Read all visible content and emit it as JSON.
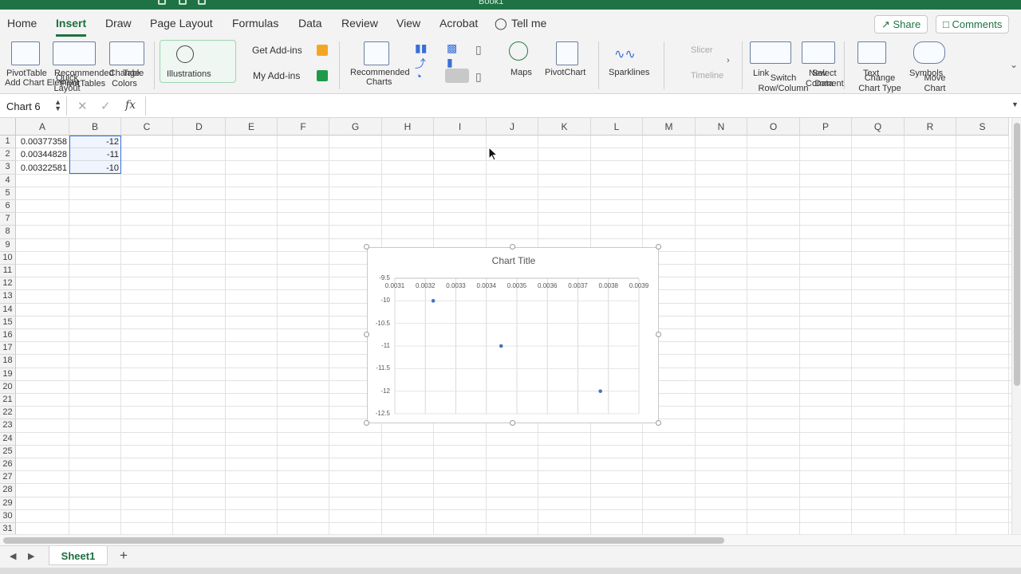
{
  "window": {
    "title": "Book1"
  },
  "tabs": [
    {
      "label": "Home"
    },
    {
      "label": "Insert"
    },
    {
      "label": "Draw"
    },
    {
      "label": "Page Layout"
    },
    {
      "label": "Formulas"
    },
    {
      "label": "Data"
    },
    {
      "label": "Review"
    },
    {
      "label": "View"
    },
    {
      "label": "Acrobat"
    },
    {
      "label": "Tell me"
    }
  ],
  "header_buttons": {
    "share": "Share",
    "comments": "Comments"
  },
  "ribbon": {
    "pivottable": "PivotTable",
    "add_chart_element": "Add Chart Element",
    "recommended_pivottables": "Recommended PivotTables",
    "quick_layout": "Quick Layout",
    "change_colors": "Change Colors",
    "table": "Table",
    "illustrations": "Illustrations",
    "get_addins": "Get Add-ins",
    "my_addins": "My Add-ins",
    "recommended_charts_1": "Recommended",
    "recommended_charts_2": "Charts",
    "maps": "Maps",
    "pivotchart": "PivotChart",
    "sparklines": "Sparklines",
    "slicer": "Slicer",
    "timeline": "Timeline",
    "link": "Link",
    "switch_rowcol": "Switch Row/Column",
    "new_comment": "New Comment",
    "select_data": "Select Data",
    "text": "Text",
    "change_chart_type": "Change Chart Type",
    "symbols": "Symbols",
    "move_chart": "Move Chart"
  },
  "formula_bar": {
    "name_box": "Chart 6",
    "fx": "fx",
    "formula": ""
  },
  "columns": [
    "A",
    "B",
    "C",
    "D",
    "E",
    "F",
    "G",
    "H",
    "I",
    "J",
    "K",
    "L",
    "M",
    "N",
    "O",
    "P",
    "Q",
    "R",
    "S"
  ],
  "rows": [
    "1",
    "2",
    "3",
    "4",
    "5",
    "6",
    "7",
    "8",
    "9",
    "10",
    "11",
    "12",
    "13",
    "14",
    "15",
    "16",
    "17",
    "18",
    "19",
    "20",
    "21",
    "22",
    "23",
    "24",
    "25",
    "26",
    "27",
    "28",
    "29",
    "30",
    "31"
  ],
  "cells": {
    "A1": "0.00377358",
    "B1": "-12",
    "A2": "0.00344828",
    "B2": "-11",
    "A3": "0.00322581",
    "B3": "-10"
  },
  "sheets": {
    "active": "Sheet1",
    "add": "+"
  },
  "chart_data": {
    "type": "scatter",
    "title": "Chart Title",
    "x": [
      0.00377358,
      0.00344828,
      0.00322581
    ],
    "y": [
      -12,
      -11,
      -10
    ],
    "x_ticks": [
      "0.0031",
      "0.0032",
      "0.0033",
      "0.0034",
      "0.0035",
      "0.0036",
      "0.0037",
      "0.0038",
      "0.0039"
    ],
    "y_ticks": [
      "-9.5",
      "-10",
      "-10.5",
      "-11",
      "-11.5",
      "-12",
      "-12.5"
    ],
    "xlim": [
      0.0031,
      0.0039
    ],
    "ylim": [
      -12.5,
      -9.5
    ],
    "x_axis_position": "top",
    "grid": true,
    "marker_color": "#4472c4"
  }
}
